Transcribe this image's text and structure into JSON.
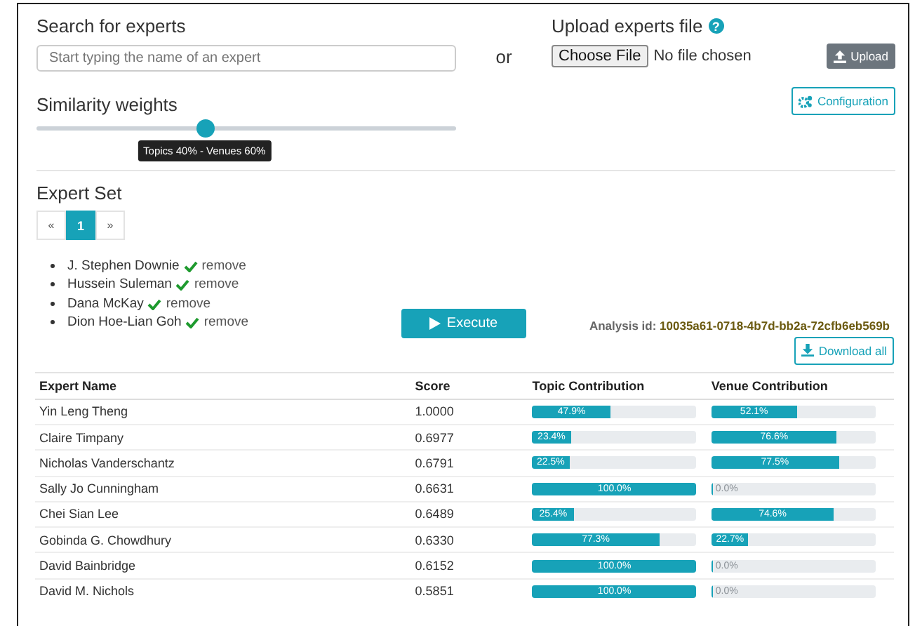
{
  "search": {
    "label": "Search for experts",
    "placeholder": "Start typing the name of an expert"
  },
  "or_label": "or",
  "upload": {
    "label": "Upload experts file",
    "help_icon": "?",
    "choose_button": "Choose File",
    "file_status": "No file chosen",
    "upload_button": "Upload"
  },
  "weights": {
    "label": "Similarity weights",
    "level": 0.4,
    "tooltip": "Topics 40% - Venues 60%"
  },
  "configuration_button": "Configuration",
  "expert_set": {
    "title": "Expert Set",
    "pagination": [
      {
        "label": "«",
        "selected": false
      },
      {
        "label": "1",
        "selected": true
      },
      {
        "label": "»",
        "selected": false
      }
    ],
    "experts": [
      {
        "name": "J. Stephen Downie",
        "action": "remove"
      },
      {
        "name": "Hussein Suleman",
        "action": "remove"
      },
      {
        "name": "Dana McKay",
        "action": "remove"
      },
      {
        "name": "Dion Hoe-Lian Goh",
        "action": "remove"
      }
    ]
  },
  "execute_button": "Execute",
  "analysis": {
    "label": "Analysis id:",
    "value": "10035a61-0718-4b7d-bb2a-72cfb6eb569b"
  },
  "download_button": "Download all",
  "table": {
    "columns": [
      "Expert Name",
      "Score",
      "Topic Contribution",
      "Venue Contribution"
    ],
    "rows": [
      {
        "name": "Yin Leng Theng",
        "score": "1.0000",
        "topic": {
          "level": 0.479,
          "label": "47.9%"
        },
        "venue": {
          "level": 0.521,
          "label": "52.1%"
        }
      },
      {
        "name": "Claire Timpany",
        "score": "0.6977",
        "topic": {
          "level": 0.234,
          "label": "23.4%"
        },
        "venue": {
          "level": 0.766,
          "label": "76.6%"
        }
      },
      {
        "name": "Nicholas Vanderschantz",
        "score": "0.6791",
        "topic": {
          "level": 0.225,
          "label": "22.5%"
        },
        "venue": {
          "level": 0.775,
          "label": "77.5%"
        }
      },
      {
        "name": "Sally Jo Cunningham",
        "score": "0.6631",
        "topic": {
          "level": 1,
          "label": "100.0%"
        },
        "venue": {
          "level": 0,
          "label": "0.0%"
        }
      },
      {
        "name": "Chei Sian Lee",
        "score": "0.6489",
        "topic": {
          "level": 0.254,
          "label": "25.4%"
        },
        "venue": {
          "level": 0.746,
          "label": "74.6%"
        }
      },
      {
        "name": "Gobinda G. Chowdhury",
        "score": "0.6330",
        "topic": {
          "level": 0.773,
          "label": "77.3%"
        },
        "venue": {
          "level": 0.227,
          "label": "22.7%"
        }
      },
      {
        "name": "David Bainbridge",
        "score": "0.6152",
        "topic": {
          "level": 1,
          "label": "100.0%"
        },
        "venue": {
          "level": 0,
          "label": "0.0%"
        }
      },
      {
        "name": "David M. Nichols",
        "score": "0.5851",
        "topic": {
          "level": 1,
          "label": "100.0%"
        },
        "venue": {
          "level": 0,
          "label": "0.0%"
        }
      }
    ]
  }
}
